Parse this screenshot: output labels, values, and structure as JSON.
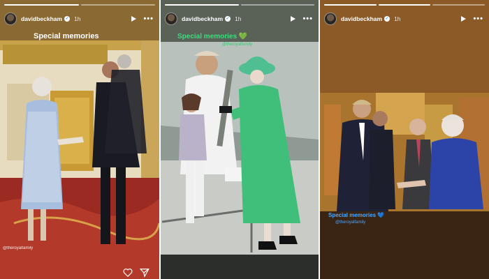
{
  "stories": [
    {
      "username": "davidbeckham",
      "verified": "✓",
      "time": "1h",
      "caption": "Special memories",
      "mention": "@theroyalfamily"
    },
    {
      "username": "davidbeckham",
      "verified": "✓",
      "time": "1h",
      "caption": "Special memories 💚",
      "mention": "@theroyalfamily"
    },
    {
      "username": "davidbeckham",
      "verified": "✓",
      "time": "1h",
      "caption": "Special memories 💙",
      "mention": "@theroyalfamily"
    }
  ],
  "controls": {
    "more": "•••"
  },
  "icons": [
    "avatar",
    "verified-icon",
    "play-icon",
    "more-icon",
    "heart-icon",
    "share-icon"
  ],
  "colors": {
    "story1_bg": "#7a5a2a",
    "story2_bg": "#4a5248",
    "story3_bg": "#8b5a26",
    "caption_green": "#33e07a",
    "caption_blue": "#4aa8ff"
  }
}
